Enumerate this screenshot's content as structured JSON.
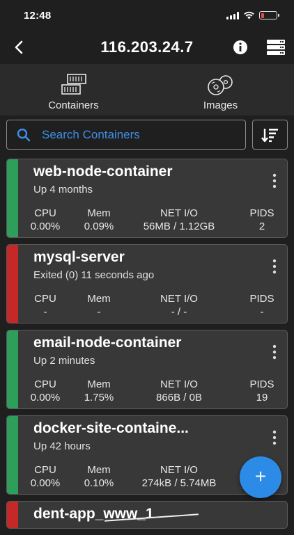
{
  "status_bar": {
    "time": "12:48"
  },
  "nav": {
    "title": "116.203.24.7"
  },
  "tabs": [
    {
      "label": "Containers",
      "icon": "containers-icon"
    },
    {
      "label": "Images",
      "icon": "images-icon"
    }
  ],
  "search": {
    "placeholder": "Search Containers"
  },
  "stat_labels": {
    "cpu": "CPU",
    "mem": "Mem",
    "net": "NET I/O",
    "pids": "PIDS"
  },
  "colors": {
    "running": "#2e9e5b",
    "exited": "#c62828",
    "accent": "#2d8be8"
  },
  "containers": [
    {
      "name": "web-node-container",
      "status": "Up 4 months",
      "state": "running",
      "cpu": "0.00%",
      "mem": "0.09%",
      "net": "56MB / 1.12GB",
      "pids": "2"
    },
    {
      "name": "mysql-server",
      "status": "Exited (0) 11 seconds ago",
      "state": "exited",
      "cpu": "-",
      "mem": "-",
      "net": "- / -",
      "pids": "-"
    },
    {
      "name": "email-node-container",
      "status": "Up 2 minutes",
      "state": "running",
      "cpu": "0.00%",
      "mem": "1.75%",
      "net": "866B / 0B",
      "pids": "19"
    },
    {
      "name": "docker-site-containe...",
      "status": "Up 42 hours",
      "state": "running",
      "cpu": "0.00%",
      "mem": "0.10%",
      "net": "274kB / 5.74MB",
      "pids": ""
    },
    {
      "name": "dent-app_www_1",
      "status": "",
      "state": "exited"
    }
  ],
  "fab": {
    "label": "+"
  }
}
